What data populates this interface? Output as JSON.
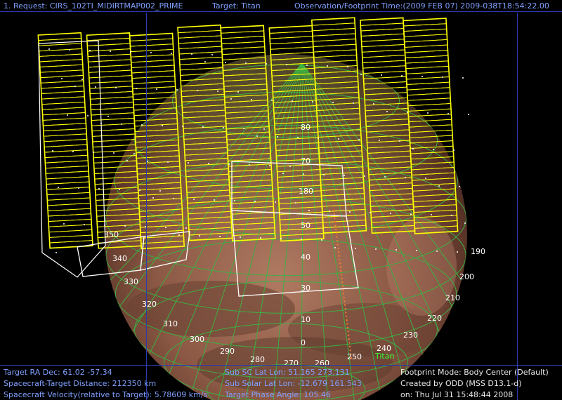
{
  "header": {
    "request": "1. Request: CIRS_102TI_MIDIRTMAP002_PRIME",
    "target": "Target: Titan",
    "time": "Observation/Footprint Time:(2009 FEB 07) 2009-038T18:54:22.00"
  },
  "footer": {
    "ra_dec": "Target RA Dec: 61.02   -57.34",
    "distance": "Spacecraft-Target Distance:  212350 km",
    "velocity": "Spacecraft Velocity(relative to Target): 5.78609 km/s",
    "sub_sc": "Sub SC Lat Lon: 51.165  273.131",
    "sub_solar": "Sub Solar Lat Lon: -12.679  161.543",
    "phase": "Target Phase Angle: 105.46",
    "mode": "Footprint Mode: Body Center (Default)",
    "created": "Created by ODD (MSS D13.1-d)",
    "date": "on: Thu Jul 31 15:48:44 2008"
  },
  "scene": {
    "target_label": "Titan",
    "lon_labels": [
      "350",
      "340",
      "330",
      "320",
      "310",
      "300",
      "290",
      "280",
      "270",
      "260",
      "250",
      "240",
      "230",
      "220",
      "210",
      "200",
      "190",
      "180"
    ],
    "lat_labels": [
      "0",
      "10",
      "30",
      "40",
      "50",
      "70",
      "80"
    ],
    "colors": {
      "footprint": "#ffff00",
      "grid": "#3cb043",
      "label": "#ffffff",
      "target_label": "#33ff33",
      "hud_blue": "#7fa0ff",
      "hud_white": "#e8e8e8",
      "frame": "#2a3bb0"
    }
  }
}
